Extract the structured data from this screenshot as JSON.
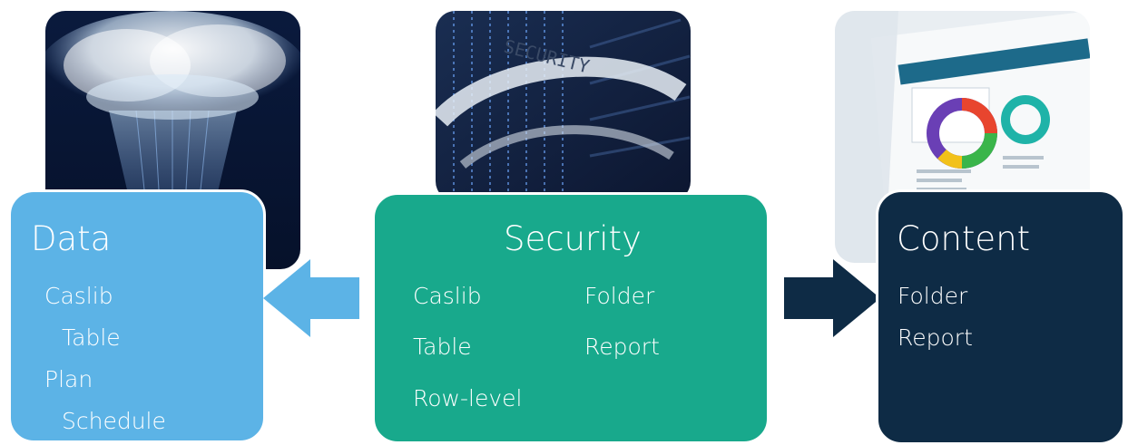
{
  "colors": {
    "data_card": "#5cb3e6",
    "security_card": "#18a98c",
    "content_card": "#0e2b45",
    "left_arrow": "#5cb3e6",
    "right_arrow": "#0e2b45"
  },
  "images": {
    "data_image": "cloud-data-streams-image",
    "security_image": "binary-code-security-ribbon-image",
    "content_image": "report-dashboard-tablet-image"
  },
  "cards": {
    "data": {
      "title": "Data",
      "items": [
        "Caslib",
        "Table",
        "Plan",
        "Schedule"
      ]
    },
    "security": {
      "title": "Security",
      "items": [
        "Caslib",
        "Folder",
        "Table",
        "Report",
        "Row-level"
      ]
    },
    "content": {
      "title": "Content",
      "items": [
        "Folder",
        "Report"
      ]
    }
  },
  "security_ribbon_text": "SECURITY"
}
